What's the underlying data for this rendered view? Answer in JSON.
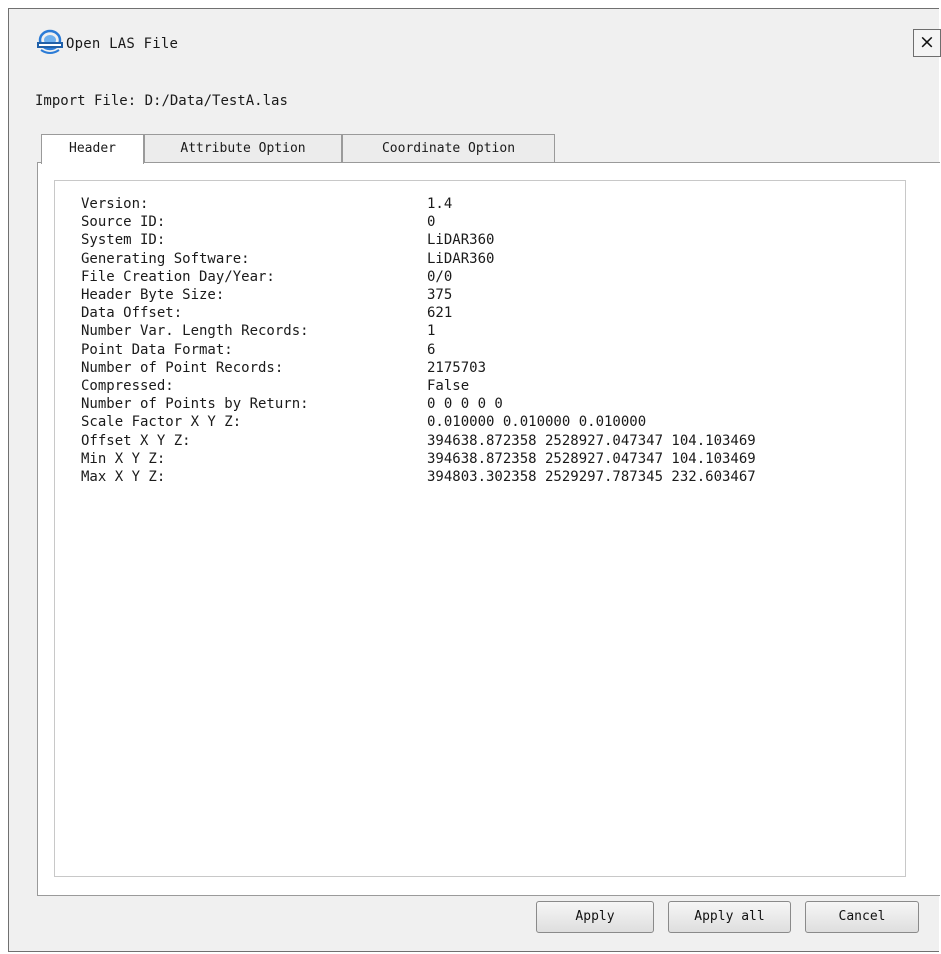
{
  "window": {
    "title": "Open LAS File",
    "close_glyph": "×"
  },
  "import": {
    "label": "Import File:",
    "path": "D:/Data/TestA.las"
  },
  "tabs": [
    {
      "label": "Header",
      "active": true
    },
    {
      "label": "Attribute Option",
      "active": false
    },
    {
      "label": "Coordinate Option",
      "active": false
    }
  ],
  "header_fields": [
    {
      "key": "Version:",
      "value": "1.4"
    },
    {
      "key": "Source ID:",
      "value": "0"
    },
    {
      "key": "System ID:",
      "value": "LiDAR360"
    },
    {
      "key": "Generating Software:",
      "value": "LiDAR360"
    },
    {
      "key": "File Creation Day/Year:",
      "value": "0/0"
    },
    {
      "key": "Header Byte Size:",
      "value": "375"
    },
    {
      "key": "Data Offset:",
      "value": "621"
    },
    {
      "key": "Number Var. Length Records:",
      "value": "1"
    },
    {
      "key": "Point Data Format:",
      "value": "6"
    },
    {
      "key": "Number of Point Records:",
      "value": "2175703"
    },
    {
      "key": "Compressed:",
      "value": "False"
    },
    {
      "key": "Number of Points by Return:",
      "value": "0 0 0 0 0"
    },
    {
      "key": "Scale Factor X Y Z:",
      "value": "0.010000 0.010000 0.010000"
    },
    {
      "key": "Offset X Y Z:",
      "value": "394638.872358 2528927.047347 104.103469"
    },
    {
      "key": "Min X Y Z:",
      "value": "394638.872358 2528927.047347 104.103469"
    },
    {
      "key": "Max X Y Z:",
      "value": "394803.302358 2529297.787345 232.603467"
    }
  ],
  "buttons": {
    "apply": "Apply",
    "apply_all": "Apply all",
    "cancel": "Cancel"
  },
  "colors": {
    "dialog_bg": "#f0f0f0",
    "panel_bg": "#ffffff",
    "icon_blue": "#2b7bd6"
  }
}
